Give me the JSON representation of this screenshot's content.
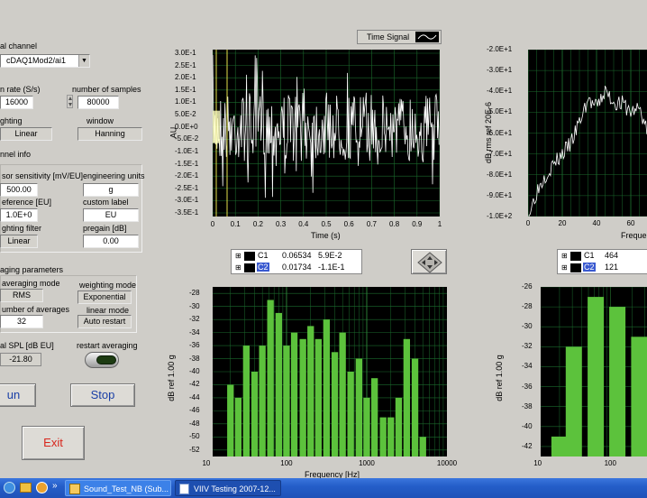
{
  "left_panel": {
    "physical_channel_label": "al channel",
    "physical_channel_value": "cDAQ1Mod2/ai1",
    "sample_rate_label": "n rate (S/s)",
    "sample_rate_value": "16000",
    "num_samples_label": "number of samples",
    "num_samples_value": "80000",
    "weighting_label": "ghting",
    "weighting_value": "Linear",
    "window_label": "window",
    "window_value": "Hanning",
    "channel_info_label": "nnel info",
    "sensor_sens_label": "sor sensitivity [mV/EU]",
    "sensor_sens_value": "500.00",
    "eng_units_label": "engineering units",
    "eng_units_value": "g",
    "reference_label": "eference [EU]",
    "reference_value": "1.0E+0",
    "custom_label_label": "custom label",
    "custom_label_value": "EU",
    "weighting_filter_label": "ghting filter",
    "weighting_filter_value": "Linear",
    "pregain_label": "pregain [dB]",
    "pregain_value": "0.00",
    "averaging_params_label": "aging parameters",
    "averaging_mode_label": "averaging mode",
    "averaging_mode_value": "RMS",
    "weighting_mode_label": "weighting mode",
    "weighting_mode_value": "Exponential",
    "num_averages_label": "umber of averages",
    "num_averages_value": "32",
    "linear_mode_label": "linear mode",
    "linear_mode_value": "Auto restart",
    "total_spl_label": "al SPL [dB EU]",
    "total_spl_value": "-21.80",
    "restart_averaging_label": "restart averaging",
    "run_label": "un",
    "stop_label": "Stop",
    "exit_label": "Exit"
  },
  "time_plot": {
    "legend_label": "Time Signal",
    "ylabel": "AU",
    "xlabel": "Time (s)",
    "yticks": [
      "3.0E-1",
      "2.5E-1",
      "2.0E-1",
      "1.5E-1",
      "1.0E-1",
      "5.0E-2",
      "0.0E+0",
      "-5.0E-2",
      "-1.0E-1",
      "-1.5E-1",
      "-2.0E-1",
      "-2.5E-1",
      "-3.0E-1",
      "-3.5E-1"
    ],
    "xticks": [
      "0",
      "0.1",
      "0.2",
      "0.3",
      "0.4",
      "0.5",
      "0.6",
      "0.7",
      "0.8",
      "0.9",
      "1"
    ]
  },
  "cursor_table_left": {
    "rows": [
      {
        "name": "C1",
        "x": "0.06534",
        "y": "5.9E-2"
      },
      {
        "name": "C2",
        "x": "0.01734",
        "y": "-1.1E-1"
      }
    ]
  },
  "cursor_table_right": {
    "rows": [
      {
        "name": "C1",
        "x": "464"
      },
      {
        "name": "C2",
        "x": "121"
      }
    ]
  },
  "spectrum_plot": {
    "ylabel": "dB rms ref 20E-6",
    "xlabel": "Freque",
    "yticks": [
      "-2.0E+1",
      "-3.0E+1",
      "-4.0E+1",
      "-5.0E+1",
      "-6.0E+1",
      "-7.0E+1",
      "-8.0E+1",
      "-9.0E+1",
      "-1.0E+2"
    ],
    "xticks": [
      "0",
      "20",
      "40",
      "60"
    ]
  },
  "octave_plot": {
    "ylabel": "dB ref 1.00 g",
    "xlabel": "Frequency [Hz]",
    "yticks": [
      "-28",
      "-30",
      "-32",
      "-34",
      "-36",
      "-38",
      "-40",
      "-42",
      "-44",
      "-46",
      "-48",
      "-50",
      "-52"
    ],
    "xticks": [
      "10",
      "100",
      "1000",
      "10000"
    ]
  },
  "octave_plot_right": {
    "ylabel": "dB ref 1.00 g",
    "yticks": [
      "-26",
      "-28",
      "-30",
      "-32",
      "-34",
      "-36",
      "-38",
      "-40",
      "-42"
    ],
    "xticks": [
      "10",
      "100"
    ]
  },
  "chart_data": [
    {
      "type": "bar",
      "title": "",
      "xlabel": "Frequency [Hz]",
      "ylabel": "dB ref 1.00 g",
      "xscale": "log",
      "ylim": [
        -53,
        -27
      ],
      "x": [
        20,
        25,
        31.5,
        40,
        50,
        63,
        80,
        100,
        125,
        160,
        200,
        250,
        315,
        400,
        500,
        630,
        800,
        1000,
        1250,
        1600,
        2000,
        2500,
        3150,
        4000,
        5000
      ],
      "values": [
        -42,
        -44,
        -36,
        -40,
        -36,
        -29,
        -31,
        -36,
        -34,
        -35,
        -33,
        -35,
        -32,
        -37,
        -34,
        -40,
        -38,
        -44,
        -41,
        -47,
        -47,
        -44,
        -35,
        -38,
        -50
      ]
    },
    {
      "type": "line",
      "title": "",
      "xlabel": "Freque",
      "ylabel": "dB rms ref 20E-6",
      "ylim": [
        -100,
        -20
      ],
      "x": [
        0,
        5,
        10,
        15,
        20,
        25,
        30,
        35,
        40,
        45,
        50,
        55,
        60,
        65,
        70
      ],
      "values": [
        -100,
        -88,
        -80,
        -75,
        -70,
        -65,
        -55,
        -44,
        -48,
        -40,
        -45,
        -46,
        -50,
        -48,
        -60
      ]
    },
    {
      "type": "bar",
      "title": "",
      "xlabel": "",
      "ylabel": "dB ref 1.00 g",
      "xscale": "log",
      "ylim": [
        -43,
        -26
      ],
      "x": [
        20,
        31.5,
        63,
        125,
        250
      ],
      "values": [
        -41,
        -32,
        -27,
        -28,
        -31
      ]
    }
  ],
  "taskbar": {
    "task1": "Sound_Test_NB (Sub...",
    "task2": "VIIV Testing 2007-12..."
  },
  "colors": {
    "plot_bg": "#000000",
    "bar_green": "#5cc23c",
    "grid": "#1b6a2c",
    "cursor": "#e3e04a",
    "exit_text": "#d8261c",
    "button_text": "#1a3fa6"
  }
}
